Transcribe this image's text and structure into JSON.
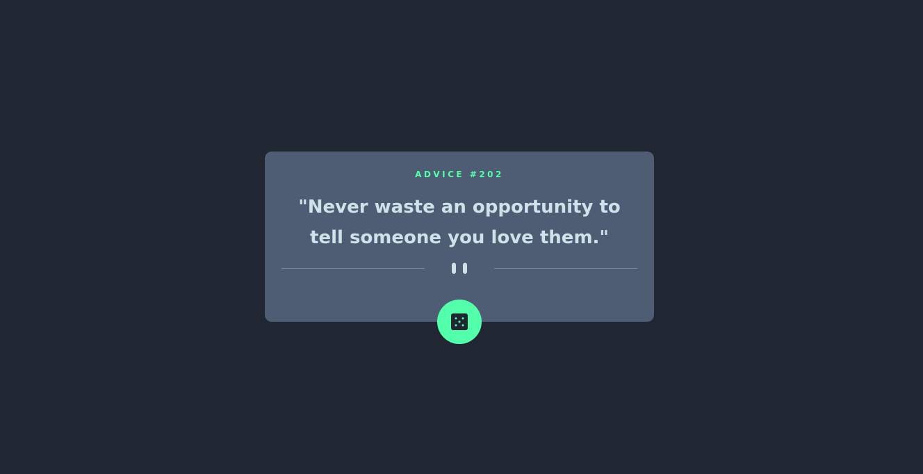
{
  "card": {
    "advice_id_label": "ADVICE #202",
    "advice_text": "\"Never waste an opportunity to tell someone you love them.\""
  },
  "divider": {
    "icon": "pause-icon"
  },
  "button": {
    "icon": "dice-icon",
    "accent_color": "#53ffaa"
  },
  "colors": {
    "background": "#202632",
    "card": "#4e5d73",
    "accent": "#53ffaa",
    "text": "#cee3e9"
  }
}
